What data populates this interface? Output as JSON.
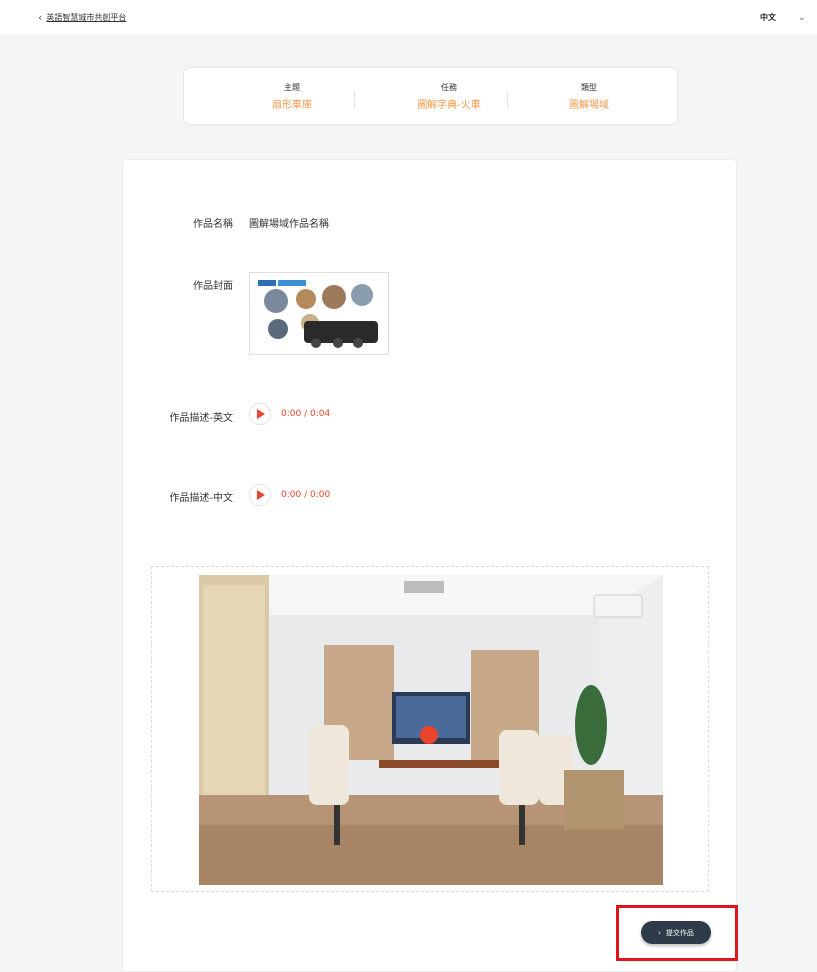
{
  "header": {
    "back_label": "英語智慧城市共創平台",
    "language": "中文"
  },
  "info": {
    "theme_title": "主題",
    "theme_value": "扇形車庫",
    "task_title": "任務",
    "task_value": "圖解字典-火車",
    "type_title": "類型",
    "type_value": "圖解場域"
  },
  "form": {
    "name_label": "作品名稱",
    "name_value": "圖解場域作品名稱",
    "cover_label": "作品封面",
    "desc_en_label": "作品描述-英文",
    "desc_en_time": "0:00 / 0:04",
    "desc_zh_label": "作品描述-中文",
    "desc_zh_time": "0:00 / 0:00"
  },
  "actions": {
    "submit_label": "提交作品"
  },
  "colors": {
    "accent": "#f2994a",
    "play": "#e8452c",
    "submit_bg": "#2d3a4a",
    "highlight": "#e0141e"
  }
}
